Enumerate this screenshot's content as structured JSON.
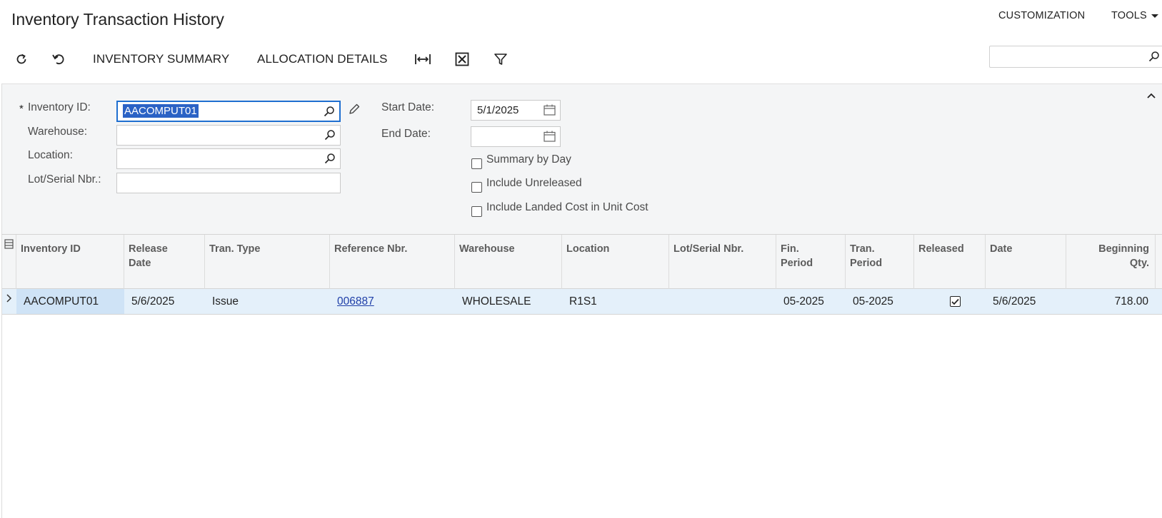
{
  "header": {
    "title": "Inventory Transaction History",
    "customization_label": "CUSTOMIZATION",
    "tools_label": "TOOLS"
  },
  "toolbar": {
    "inventory_summary_label": "INVENTORY SUMMARY",
    "allocation_details_label": "ALLOCATION DETAILS",
    "search_value": ""
  },
  "filters": {
    "inventory_id_label": "Inventory ID:",
    "required_marker": "*",
    "inventory_id_value": "AACOMPUT01",
    "warehouse_label": "Warehouse:",
    "warehouse_value": "",
    "location_label": "Location:",
    "location_value": "",
    "lot_serial_label": "Lot/Serial Nbr.:",
    "lot_serial_value": "",
    "start_date_label": "Start Date:",
    "start_date_value": "5/1/2025",
    "end_date_label": "End Date:",
    "end_date_value": "",
    "summary_by_day_label": "Summary by Day",
    "summary_by_day_checked": false,
    "include_unreleased_label": "Include Unreleased",
    "include_unreleased_checked": false,
    "include_landed_cost_label": "Include Landed Cost in Unit Cost",
    "include_landed_cost_checked": false
  },
  "grid": {
    "columns": [
      {
        "line1": "Inventory ID",
        "line2": ""
      },
      {
        "line1": "Release",
        "line2": "Date"
      },
      {
        "line1": "Tran. Type",
        "line2": ""
      },
      {
        "line1": "Reference Nbr.",
        "line2": ""
      },
      {
        "line1": "Warehouse",
        "line2": ""
      },
      {
        "line1": "Location",
        "line2": ""
      },
      {
        "line1": "Lot/Serial Nbr.",
        "line2": ""
      },
      {
        "line1": "Fin.",
        "line2": "Period"
      },
      {
        "line1": "Tran.",
        "line2": "Period"
      },
      {
        "line1": "Released",
        "line2": ""
      },
      {
        "line1": "Date",
        "line2": ""
      },
      {
        "line1": "Beginning",
        "line2": "Qty."
      }
    ],
    "rows": [
      {
        "inventory_id": "AACOMPUT01",
        "release_date": "5/6/2025",
        "tran_type": "Issue",
        "reference_nbr": "006887",
        "warehouse": "WHOLESALE",
        "location": "R1S1",
        "lot_serial": "",
        "fin_period": "05-2025",
        "tran_period": "05-2025",
        "released": true,
        "date": "5/6/2025",
        "beginning_qty": "718.00"
      }
    ]
  },
  "colors": {
    "accent": "#1f6fd0",
    "selected_row": "#e4f0fa",
    "panel_bg": "#f4f5f6",
    "link": "#1f3fa8"
  }
}
